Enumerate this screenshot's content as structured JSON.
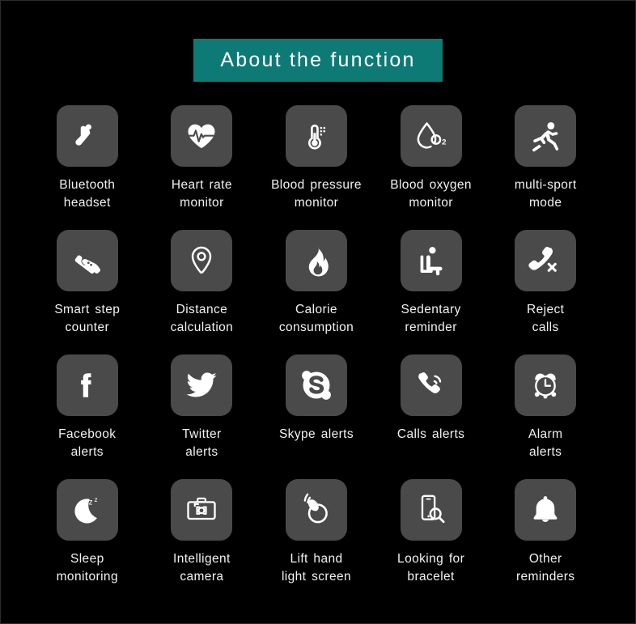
{
  "header": {
    "title": "About  the  function",
    "banner_color": "#0d7a76",
    "text_color": "#ffffff"
  },
  "theme": {
    "background": "#000000",
    "tile_color": "#4a4a4a",
    "label_color": "#f2f2f2",
    "glyph_color": "#ffffff"
  },
  "features": [
    {
      "icon": "bluetooth-headset-icon",
      "label": "Bluetooth\nheadset"
    },
    {
      "icon": "heart-rate-icon",
      "label": "Heart  rate\nmonitor"
    },
    {
      "icon": "thermometer-icon",
      "label": "Blood pressure\nmonitor"
    },
    {
      "icon": "blood-oxygen-droplet-icon",
      "label": "Blood  oxygen\nmonitor"
    },
    {
      "icon": "running-person-icon",
      "label": "multi-sport\nmode"
    },
    {
      "icon": "shoe-icon",
      "label": "Smart  step\ncounter"
    },
    {
      "icon": "map-pin-icon",
      "label": "Distance\ncalculation"
    },
    {
      "icon": "flame-icon",
      "label": "Calorie\nconsumption"
    },
    {
      "icon": "sitting-person-icon",
      "label": "Sedentary\nreminder"
    },
    {
      "icon": "phone-reject-icon",
      "label": "Reject\ncalls"
    },
    {
      "icon": "facebook-icon",
      "label": "Facebook\nalerts"
    },
    {
      "icon": "twitter-bird-icon",
      "label": "Twitter\nalerts"
    },
    {
      "icon": "skype-icon",
      "label": "Skype  alerts"
    },
    {
      "icon": "phone-ringing-icon",
      "label": "Calls  alerts"
    },
    {
      "icon": "alarm-clock-icon",
      "label": "Alarm\nalerts"
    },
    {
      "icon": "moon-sleep-icon",
      "label": "Sleep\nmonitoring"
    },
    {
      "icon": "camera-icon",
      "label": "Intelligent\ncamera"
    },
    {
      "icon": "lift-hand-watch-icon",
      "label": "Lift  hand\nlight  screen"
    },
    {
      "icon": "phone-search-icon",
      "label": "Looking  for\nbracelet"
    },
    {
      "icon": "bell-icon",
      "label": "Other\nreminders"
    }
  ]
}
